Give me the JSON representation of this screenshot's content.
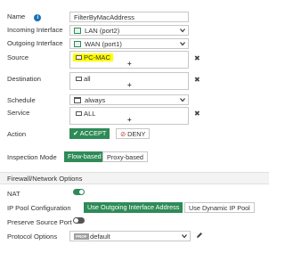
{
  "form": {
    "name": {
      "label": "Name",
      "value": "FilterByMacAddress"
    },
    "incoming_interface": {
      "label": "Incoming Interface",
      "value": "LAN (port2)"
    },
    "outgoing_interface": {
      "label": "Outgoing Interface",
      "value": "WAN (port1)"
    },
    "source": {
      "label": "Source",
      "entry": "PC-MAC",
      "highlight_color": "#ffff00"
    },
    "destination": {
      "label": "Destination",
      "entry": "all"
    },
    "schedule": {
      "label": "Schedule",
      "value": "always"
    },
    "service": {
      "label": "Service",
      "entry": "ALL"
    },
    "action": {
      "label": "Action",
      "accept": "ACCEPT",
      "deny": "DENY",
      "selected": "ACCEPT",
      "accept_color": "#2e8b57"
    },
    "inspection_mode": {
      "label": "Inspection Mode",
      "options": [
        "Flow-based",
        "Proxy-based"
      ],
      "selected": "Flow-based"
    }
  },
  "firewall_options": {
    "section_title": "Firewall/Network Options",
    "nat": {
      "label": "NAT",
      "enabled": true
    },
    "ip_pool": {
      "label": "IP Pool Configuration",
      "options": [
        "Use Outgoing Interface Address",
        "Use Dynamic IP Pool"
      ],
      "selected": "Use Outgoing Interface Address"
    },
    "preserve_source_port": {
      "label": "Preserve Source Port",
      "enabled": false
    },
    "protocol_options": {
      "label": "Protocol Options",
      "badge": "PROF",
      "value": "default"
    }
  }
}
